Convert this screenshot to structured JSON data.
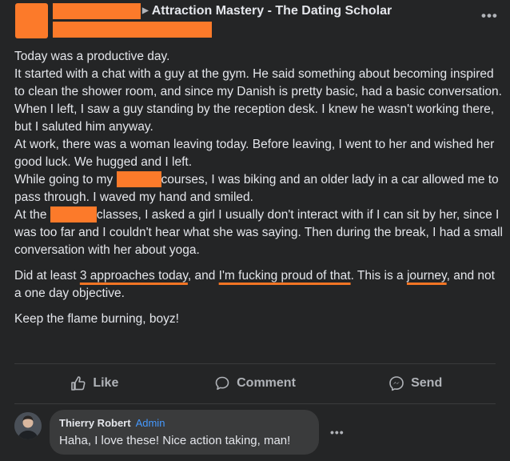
{
  "post": {
    "group_arrow": "▶",
    "group_name": "Attraction Mastery - The Dating Scholar",
    "more_label": "•••"
  },
  "body": {
    "l1": "Today was a productive day.",
    "l2": "It started with a chat with a guy at the gym. He said something about becoming inspired to clean the shower room, and since my Danish is pretty basic, had a basic conversation.",
    "l3": "When I left, I saw a guy standing by the reception desk. I knew he wasn't working there, but I saluted him anyway.",
    "l4": "At work, there was a woman leaving today. Before leaving, I went to her and wished her good luck. We hugged and I left.",
    "l5_a": "While going to my ",
    "l5_b": "courses, I was biking and an older lady in a car allowed me to pass through. I waved my hand and smiled.",
    "l6_a": "At the ",
    "l6_b": "classes, I asked a girl I usually don't interact with if I can sit by her, since I was too far and I couldn't hear what she was saying. Then during the break, I had a small conversation with her about yoga.",
    "l7_a": "Did at least ",
    "l7_u1": "3 approaches today",
    "l7_b": ", and ",
    "l7_u2": "I'm fucking proud of that",
    "l7_c": ". This is a ",
    "l7_u3": "journey",
    "l7_d": ", and not a one day objective.",
    "l8": "Keep the flame burning, boyz!"
  },
  "actions": {
    "like": "Like",
    "comment": "Comment",
    "send": "Send"
  },
  "comment": {
    "author": "Thierry Robert",
    "badge": "Admin",
    "text": "Haha, I love these! Nice action taking, man!",
    "more_label": "•••"
  },
  "colors": {
    "background": "#242526",
    "redaction": "#fc7a2a",
    "underline": "#f57524",
    "admin_badge": "#4599ff",
    "muted": "#b0b3b8"
  },
  "icons": {
    "like": "thumbs-up-icon",
    "comment": "speech-bubble-icon",
    "send": "messenger-icon"
  }
}
